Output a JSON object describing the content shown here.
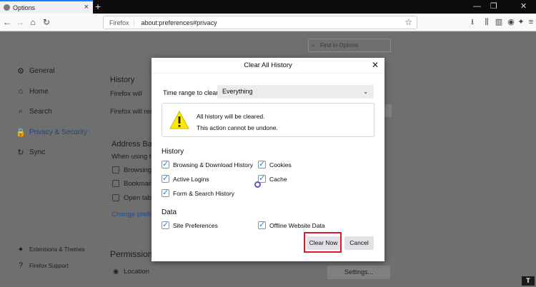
{
  "tab": {
    "title": "Options",
    "close": "×",
    "new_tab": "+"
  },
  "window_controls": {
    "minimize": "—",
    "restore": "❐",
    "close": "✕"
  },
  "nav": {
    "back": "←",
    "forward": "→",
    "home": "⌂",
    "reload": "↻",
    "brand": "Firefox",
    "url": "about:preferences#privacy",
    "star": "☆",
    "tool_icons": [
      "download-icon",
      "library-icon",
      "sidebar-icon",
      "account-icon",
      "extensions-icon",
      "menu-icon"
    ],
    "tool_glyphs": [
      "⭳",
      "⫼",
      "▥",
      "◉",
      "✦",
      "≡"
    ]
  },
  "page": {
    "find_placeholder": "Find in Options",
    "sidebar": [
      {
        "label": "General",
        "icon": "⚙"
      },
      {
        "label": "Home",
        "icon": "⌂"
      },
      {
        "label": "Search",
        "icon": "⌕"
      },
      {
        "label": "Privacy & Security",
        "icon": "🔒"
      },
      {
        "label": "Sync",
        "icon": "↻"
      }
    ],
    "sidebar_bottom": [
      {
        "label": "Extensions & Themes",
        "icon": "✦"
      },
      {
        "label": "Firefox Support",
        "icon": "?"
      }
    ],
    "history_heading": "History",
    "firefox_will": "Firefox will",
    "firefox_will_remember": "Firefox will rem",
    "address_bar_heading": "Address Bar",
    "when_using": "When using th",
    "browsing": "Browsing",
    "bookmarks": "Bookmark",
    "open_tabs": "Open tabs",
    "change_prefs": "Change prefere",
    "permissions_heading": "Permission",
    "location": "Location",
    "settings_button": "Settings..."
  },
  "dialog": {
    "title": "Clear All History",
    "close": "✕",
    "time_range_label": "Time range to clear:",
    "time_range_value": "Everything",
    "warning_line1": "All history will be cleared.",
    "warning_line2": "This action cannot be undone.",
    "history_heading": "History",
    "history_options": [
      {
        "label": "Browsing & Download History",
        "checked": true
      },
      {
        "label": "Cookies",
        "checked": true
      },
      {
        "label": "Active Logins",
        "checked": true
      },
      {
        "label": "Cache",
        "checked": true
      },
      {
        "label": "Form & Search History",
        "checked": true
      }
    ],
    "data_heading": "Data",
    "data_options": [
      {
        "label": "Site Preferences",
        "checked": true
      },
      {
        "label": "Offline Website Data",
        "checked": true
      }
    ],
    "clear_now": "Clear Now",
    "cancel": "Cancel"
  },
  "corner_badge": "T",
  "colors": {
    "accent": "#0a84ff",
    "highlight": "#e0162b",
    "dim": "#6f6f6f"
  }
}
